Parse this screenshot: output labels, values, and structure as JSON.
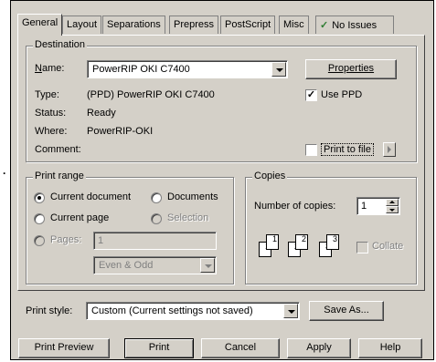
{
  "tabs": [
    {
      "label": "General"
    },
    {
      "label": "Layout"
    },
    {
      "label": "Separations"
    },
    {
      "label": "Prepress"
    },
    {
      "label": "PostScript"
    },
    {
      "label": "Misc"
    },
    {
      "label": "No Issues",
      "icon": "checkmark-icon"
    }
  ],
  "destination": {
    "legend": "Destination",
    "name_label": "Name:",
    "name_value": "PowerRIP OKI C7400",
    "properties_label": "Properties",
    "type_label": "Type:",
    "type_value": "(PPD) PowerRIP OKI C7400",
    "status_label": "Status:",
    "status_value": "Ready",
    "where_label": "Where:",
    "where_value": "PowerRIP-OKI",
    "comment_label": "Comment:",
    "use_ppd_label": "Use PPD",
    "use_ppd_checked": true,
    "print_to_file_label": "Print to file",
    "print_to_file_checked": false
  },
  "print_range": {
    "legend": "Print range",
    "current_document": "Current document",
    "documents": "Documents",
    "current_page": "Current page",
    "selection": "Selection",
    "pages_label": "Pages:",
    "pages_value": "1",
    "subset_value": "Even & Odd",
    "selected": "current_document"
  },
  "copies": {
    "legend": "Copies",
    "number_label": "Number of copies:",
    "number_value": "1",
    "collate_label": "Collate",
    "collate_checked": false,
    "page_numbers": [
      "1",
      "1",
      "2",
      "2",
      "3",
      "3"
    ]
  },
  "print_style": {
    "label": "Print style:",
    "value": "Custom (Current settings not saved)",
    "save_as_label": "Save As..."
  },
  "footer": {
    "preview": "Print Preview",
    "print": "Print",
    "cancel": "Cancel",
    "apply": "Apply",
    "help": "Help"
  },
  "colors": {
    "dialog_bg": "#d4d0c8",
    "checkmark": "#2e7d32"
  }
}
